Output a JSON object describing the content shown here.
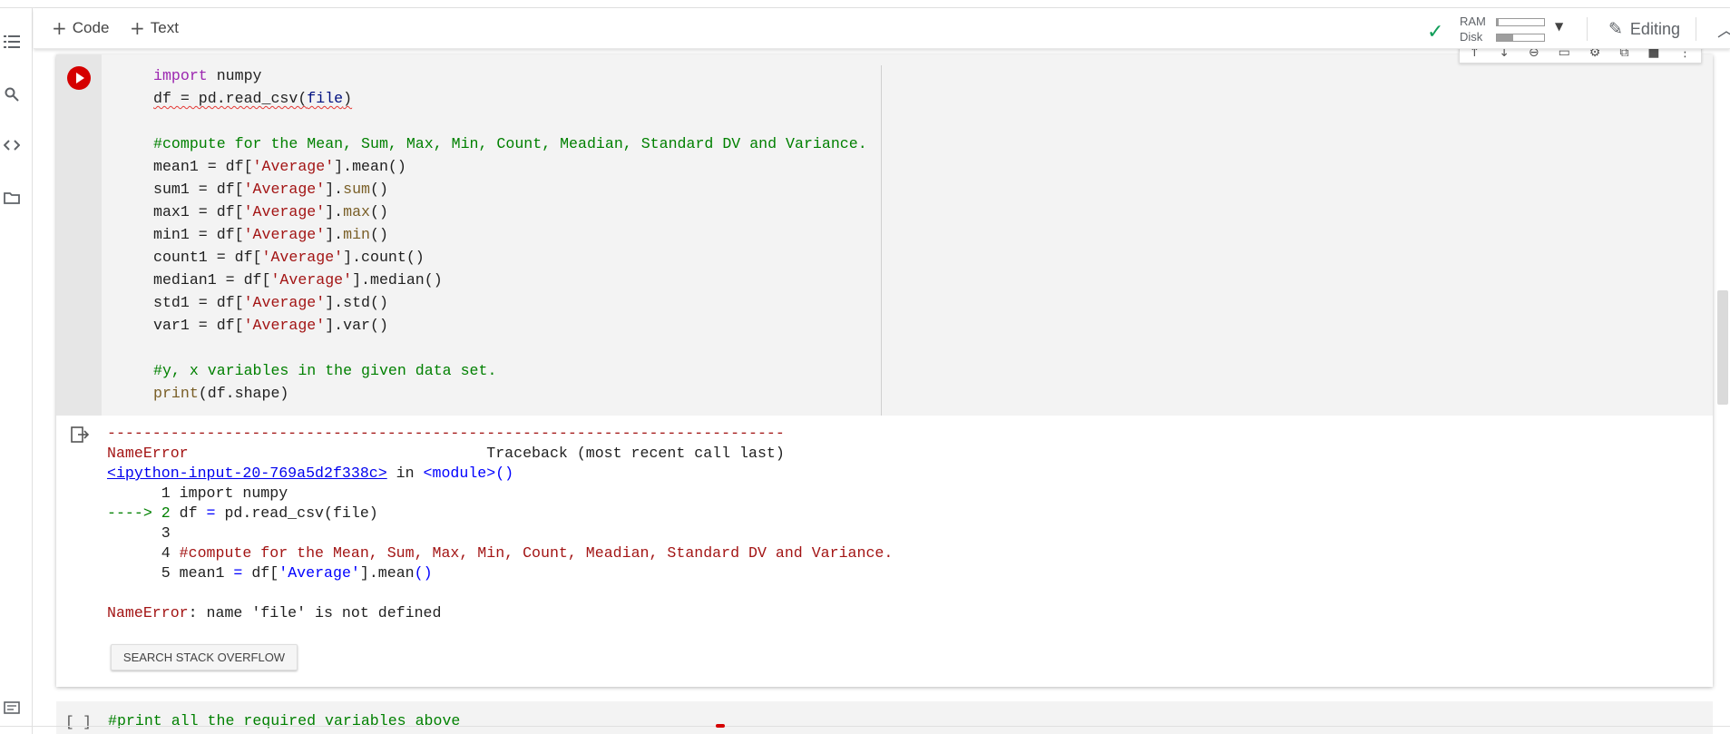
{
  "toolbar": {
    "add_code": "Code",
    "add_text": "Text",
    "ram_label": "RAM",
    "disk_label": "Disk",
    "ram_fraction": 0.04,
    "disk_fraction": 0.35,
    "editing_label": "Editing"
  },
  "colors": {
    "run_button": "#d50000",
    "checkmark": "#0f9d58",
    "comment": "#008000",
    "string": "#a31515",
    "keyword": "#9c27b0"
  },
  "code_cell": {
    "lines": [
      [
        {
          "t": "import",
          "c": "kw"
        },
        {
          "t": " numpy",
          "c": ""
        }
      ],
      [
        {
          "t": "df = pd.read_csv(",
          "c": "squig"
        },
        {
          "t": "file",
          "c": "squig var"
        },
        {
          "t": ")",
          "c": "squig"
        }
      ],
      [
        {
          "t": "",
          "c": ""
        }
      ],
      [
        {
          "t": "#compute for the Mean, Sum, Max, Min, Count, Meadian, Standard DV and Variance.",
          "c": "cm"
        }
      ],
      [
        {
          "t": "mean1 = df[",
          "c": ""
        },
        {
          "t": "'Average'",
          "c": "str"
        },
        {
          "t": "].mean()",
          "c": ""
        }
      ],
      [
        {
          "t": "sum1 = df[",
          "c": ""
        },
        {
          "t": "'Average'",
          "c": "str"
        },
        {
          "t": "].",
          "c": ""
        },
        {
          "t": "sum",
          "c": "fn"
        },
        {
          "t": "()",
          "c": ""
        }
      ],
      [
        {
          "t": "max1 = df[",
          "c": ""
        },
        {
          "t": "'Average'",
          "c": "str"
        },
        {
          "t": "].",
          "c": ""
        },
        {
          "t": "max",
          "c": "fn"
        },
        {
          "t": "()",
          "c": ""
        }
      ],
      [
        {
          "t": "min1 = df[",
          "c": ""
        },
        {
          "t": "'Average'",
          "c": "str"
        },
        {
          "t": "].",
          "c": ""
        },
        {
          "t": "min",
          "c": "fn"
        },
        {
          "t": "()",
          "c": ""
        }
      ],
      [
        {
          "t": "count1 = df[",
          "c": ""
        },
        {
          "t": "'Average'",
          "c": "str"
        },
        {
          "t": "].count()",
          "c": ""
        }
      ],
      [
        {
          "t": "median1 = df[",
          "c": ""
        },
        {
          "t": "'Average'",
          "c": "str"
        },
        {
          "t": "].median()",
          "c": ""
        }
      ],
      [
        {
          "t": "std1 = df[",
          "c": ""
        },
        {
          "t": "'Average'",
          "c": "str"
        },
        {
          "t": "].std()",
          "c": ""
        }
      ],
      [
        {
          "t": "var1 = df[",
          "c": ""
        },
        {
          "t": "'Average'",
          "c": "str"
        },
        {
          "t": "].var()",
          "c": ""
        }
      ],
      [
        {
          "t": "",
          "c": ""
        }
      ],
      [
        {
          "t": "#y, x variables in the given data set.",
          "c": "cm"
        }
      ],
      [
        {
          "t": "print",
          "c": "fn"
        },
        {
          "t": "(df.shape)",
          "c": ""
        }
      ]
    ]
  },
  "output": {
    "lines": [
      [
        {
          "t": "---------------------------------------------------------------------------",
          "c": "tred"
        }
      ],
      [
        {
          "t": "NameError",
          "c": "tred"
        },
        {
          "t": "                                 Traceback (most recent call last)",
          "c": ""
        }
      ],
      [
        {
          "t": "<ipython-input-20-769a5d2f338c>",
          "c": "tlink"
        },
        {
          "t": " in ",
          "c": ""
        },
        {
          "t": "<module>",
          "c": "tblue"
        },
        {
          "t": "()",
          "c": "tblue"
        }
      ],
      [
        {
          "t": "      1 import numpy",
          "c": ""
        }
      ],
      [
        {
          "t": "----> 2 ",
          "c": "tgreen"
        },
        {
          "t": "df ",
          "c": ""
        },
        {
          "t": "=",
          "c": "tblue"
        },
        {
          "t": " pd.read_csv(file)",
          "c": ""
        }
      ],
      [
        {
          "t": "      3",
          "c": ""
        }
      ],
      [
        {
          "t": "      4 ",
          "c": ""
        },
        {
          "t": "#compute for the Mean, Sum, Max, Min, Count, Meadian, Standard DV and Variance.",
          "c": "tred"
        }
      ],
      [
        {
          "t": "      5 mean1 ",
          "c": ""
        },
        {
          "t": "=",
          "c": "tblue"
        },
        {
          "t": " df[",
          "c": ""
        },
        {
          "t": "'Average'",
          "c": "tblue"
        },
        {
          "t": "].mean",
          "c": ""
        },
        {
          "t": "()",
          "c": "tblue"
        }
      ],
      [
        {
          "t": "",
          "c": ""
        }
      ],
      [
        {
          "t": "NameError",
          "c": "tred"
        },
        {
          "t": ": name 'file' is not defined",
          "c": ""
        }
      ]
    ],
    "search_button": "SEARCH STACK OVERFLOW"
  },
  "next_cell": {
    "brackets": "[ ]",
    "code_preview": "#print all the required variables above"
  }
}
